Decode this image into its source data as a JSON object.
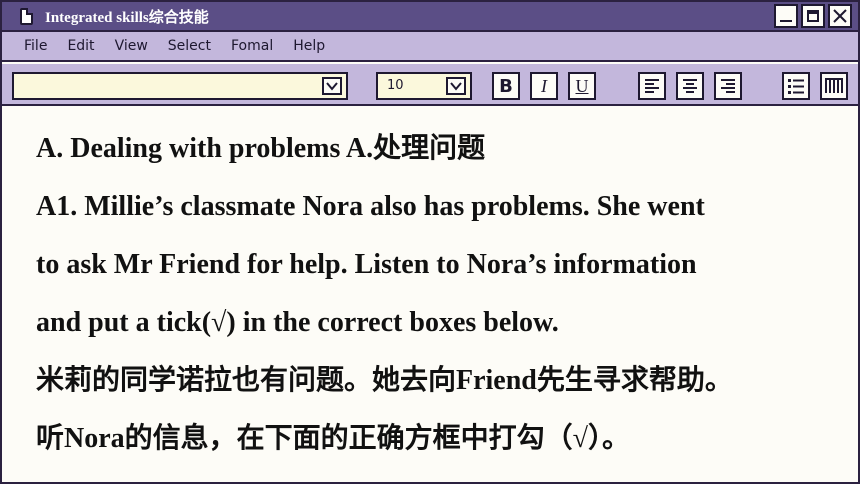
{
  "window": {
    "title": "Integrated skills综合技能"
  },
  "menu": {
    "items": [
      "File",
      "Edit",
      "View",
      "Select",
      "Fomal",
      "Help"
    ]
  },
  "toolbar": {
    "font_value": "",
    "size_value": "10",
    "bold_label": "B",
    "italic_label": "I",
    "underline_label": "U"
  },
  "content": {
    "heading": "A. Dealing with problems A.处理问题",
    "lines": [
      "A1. Millie’s classmate Nora also has problems. She went",
      "to ask Mr Friend for help. Listen to Nora’s information",
      "and put a tick(√) in the correct boxes below.",
      "米莉的同学诺拉也有问题。她去向Friend先生寻求帮助。",
      "听Nora的信息，在下面的正确方框中打勾（√）。"
    ]
  },
  "colors": {
    "titlebar": "#5b4e86",
    "menubar": "#c3b7dc",
    "input_bg": "#fbf8dc",
    "border": "#2b2140"
  }
}
